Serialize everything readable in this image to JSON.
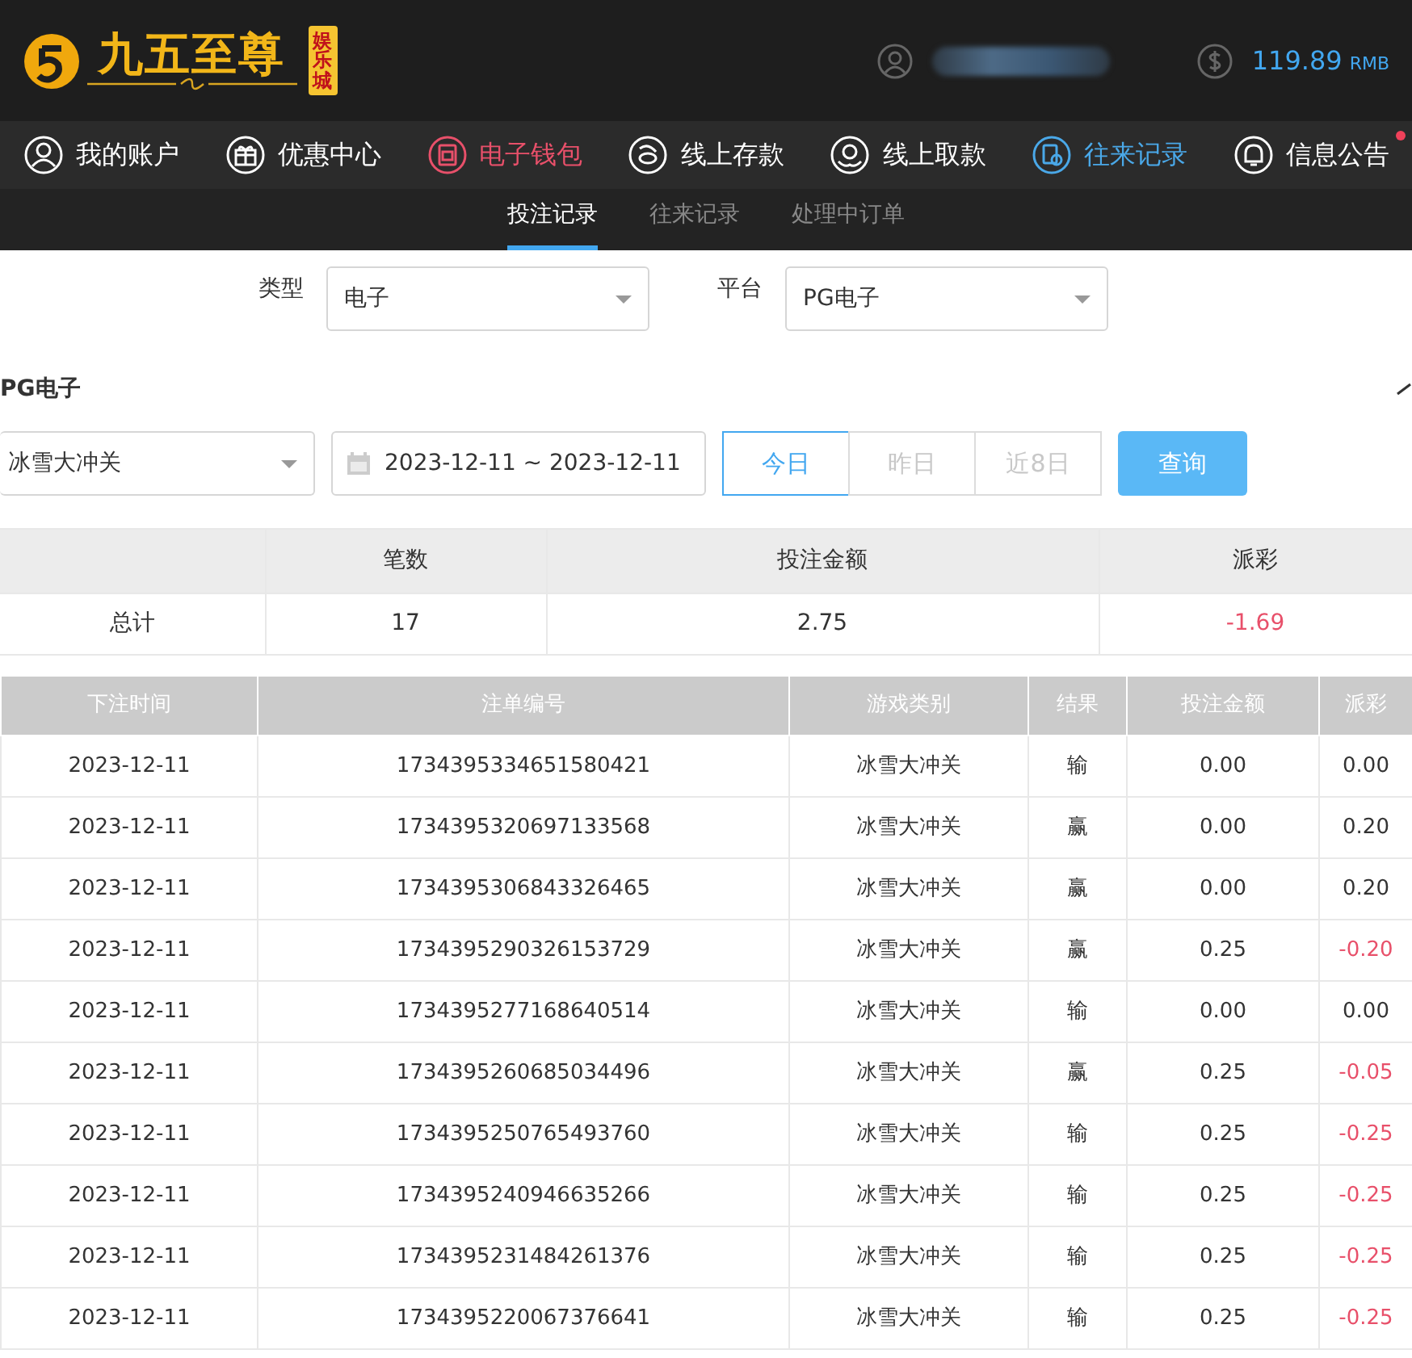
{
  "logo": {
    "name": "九五至尊",
    "tag": "娱乐城"
  },
  "account": {
    "balance": "119.89",
    "currency": "RMB"
  },
  "nav": [
    {
      "label": "我的账户",
      "kind": "user",
      "color": "#ffffff"
    },
    {
      "label": "优惠中心",
      "kind": "gift",
      "color": "#ffffff"
    },
    {
      "label": "电子钱包",
      "kind": "wallet",
      "color": "#e8506a"
    },
    {
      "label": "线上存款",
      "kind": "deposit",
      "color": "#ffffff"
    },
    {
      "label": "线上取款",
      "kind": "withdraw",
      "color": "#ffffff"
    },
    {
      "label": "往来记录",
      "kind": "record",
      "color": "#4aa8e8"
    },
    {
      "label": "信息公告",
      "kind": "bell",
      "color": "#ffffff",
      "unread": true
    }
  ],
  "subtabs": [
    {
      "label": "投注记录",
      "selected": true
    },
    {
      "label": "往来记录",
      "selected": false
    },
    {
      "label": "处理中订单",
      "selected": false
    }
  ],
  "filters": [
    {
      "label": "类型",
      "value": "电子"
    },
    {
      "label": "平台",
      "value": "PG电子"
    }
  ],
  "section_title": "PG电子",
  "game_select": "冰雪大冲关",
  "date_range": "2023-12-11 ~ 2023-12-11",
  "quick_dates": [
    {
      "label": "今日",
      "selected": true
    },
    {
      "label": "昨日",
      "selected": false
    },
    {
      "label": "近8日",
      "selected": false
    }
  ],
  "query_button": "查询",
  "summary": {
    "columns": [
      "笔数",
      "投注金额",
      "派彩"
    ],
    "label": "总计",
    "values": [
      "17",
      "2.75",
      "-1.69"
    ],
    "payout_loss": true
  },
  "table": {
    "columns": [
      "下注时间",
      "注单编号",
      "游戏类别",
      "结果",
      "投注金额",
      "派彩"
    ],
    "rows": [
      {
        "cells": [
          "2023-12-11",
          "1734395334651580421",
          "冰雪大冲关",
          "输",
          "0.00",
          "0.00"
        ],
        "payout_loss": false
      },
      {
        "cells": [
          "2023-12-11",
          "1734395320697133568",
          "冰雪大冲关",
          "赢",
          "0.00",
          "0.20"
        ],
        "payout_loss": false
      },
      {
        "cells": [
          "2023-12-11",
          "1734395306843326465",
          "冰雪大冲关",
          "赢",
          "0.00",
          "0.20"
        ],
        "payout_loss": false
      },
      {
        "cells": [
          "2023-12-11",
          "1734395290326153729",
          "冰雪大冲关",
          "赢",
          "0.25",
          "-0.20"
        ],
        "payout_loss": true
      },
      {
        "cells": [
          "2023-12-11",
          "1734395277168640514",
          "冰雪大冲关",
          "输",
          "0.00",
          "0.00"
        ],
        "payout_loss": false
      },
      {
        "cells": [
          "2023-12-11",
          "1734395260685034496",
          "冰雪大冲关",
          "赢",
          "0.25",
          "-0.05"
        ],
        "payout_loss": true
      },
      {
        "cells": [
          "2023-12-11",
          "1734395250765493760",
          "冰雪大冲关",
          "输",
          "0.25",
          "-0.25"
        ],
        "payout_loss": true
      },
      {
        "cells": [
          "2023-12-11",
          "1734395240946635266",
          "冰雪大冲关",
          "输",
          "0.25",
          "-0.25"
        ],
        "payout_loss": true
      },
      {
        "cells": [
          "2023-12-11",
          "1734395231484261376",
          "冰雪大冲关",
          "输",
          "0.25",
          "-0.25"
        ],
        "payout_loss": true
      },
      {
        "cells": [
          "2023-12-11",
          "1734395220067376641",
          "冰雪大冲关",
          "输",
          "0.25",
          "-0.25"
        ],
        "payout_loss": true
      }
    ]
  }
}
